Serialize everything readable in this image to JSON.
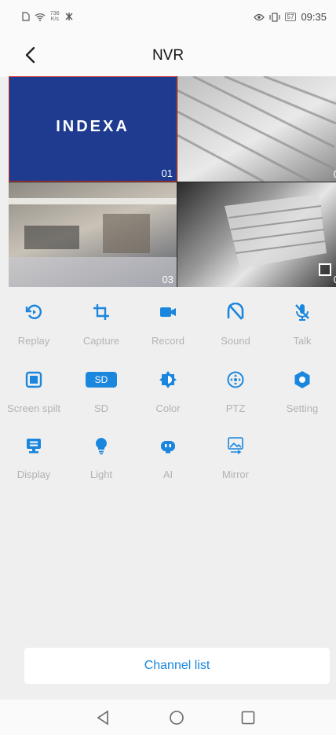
{
  "statusbar": {
    "netspeed_value": "736",
    "netspeed_unit": "K/s",
    "battery": "57",
    "time": "09:35"
  },
  "header": {
    "title": "NVR"
  },
  "cameras": [
    {
      "brand": "INDEXA",
      "channel": "01"
    },
    {
      "channel": "0"
    },
    {
      "channel": "03"
    },
    {
      "channel": "0"
    }
  ],
  "actions": [
    {
      "label": "Replay",
      "icon": "replay-icon"
    },
    {
      "label": "Capture",
      "icon": "crop-icon"
    },
    {
      "label": "Record",
      "icon": "video-camera-icon"
    },
    {
      "label": "Sound",
      "icon": "sound-off-icon"
    },
    {
      "label": "Talk",
      "icon": "mic-off-icon"
    },
    {
      "label": "Screen spilt",
      "icon": "square-icon"
    },
    {
      "label": "SD",
      "badge": "SD",
      "icon": "sd-card-icon"
    },
    {
      "label": "Color",
      "icon": "brightness-icon"
    },
    {
      "label": "PTZ",
      "icon": "ptz-icon"
    },
    {
      "label": "Setting",
      "icon": "gear-icon"
    },
    {
      "label": "Display",
      "icon": "display-icon"
    },
    {
      "label": "Light",
      "icon": "bulb-icon"
    },
    {
      "label": "AI",
      "icon": "robot-icon"
    },
    {
      "label": "Mirror",
      "icon": "mirror-icon"
    }
  ],
  "channel_list_label": "Channel list",
  "accent_color": "#1b86dd"
}
